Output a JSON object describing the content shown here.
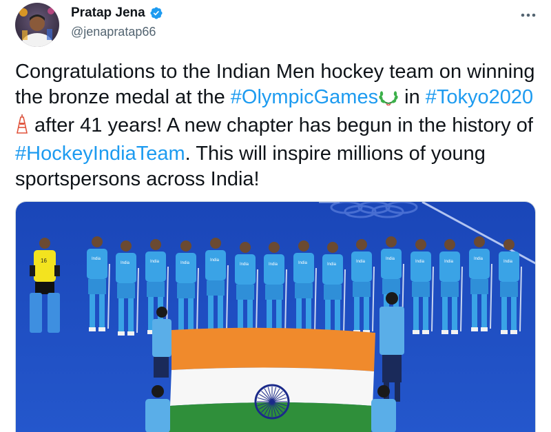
{
  "author": {
    "name": "Pratap Jena",
    "handle": "@jenapratap66",
    "verified_icon": "verified-badge-icon",
    "avatar_icon": "avatar-photo"
  },
  "more_icon": "more-options-icon",
  "tweet": {
    "t1": "Congratulations to the Indian Men hockey team on winning the bronze medal at the ",
    "tag1": "#OlympicGames",
    "t2": " in ",
    "tag2": "#Tokyo2020",
    "t3": " after 41 years! A new chapter has begun in the history of ",
    "tag3": "#HockeyIndiaTeam",
    "t4": ". This will inspire millions of young sportspersons across India!"
  },
  "media": {
    "description_icon": "team-photo-image",
    "jersey_text": "India",
    "goalkeeper_number": "16"
  },
  "colors": {
    "link": "#1d9bf0",
    "turf": "#1d4fbf",
    "jersey": "#3aa3e6",
    "saffron": "#f08a2c",
    "green": "#2f8f3a",
    "navy": "#1b2a8a"
  }
}
